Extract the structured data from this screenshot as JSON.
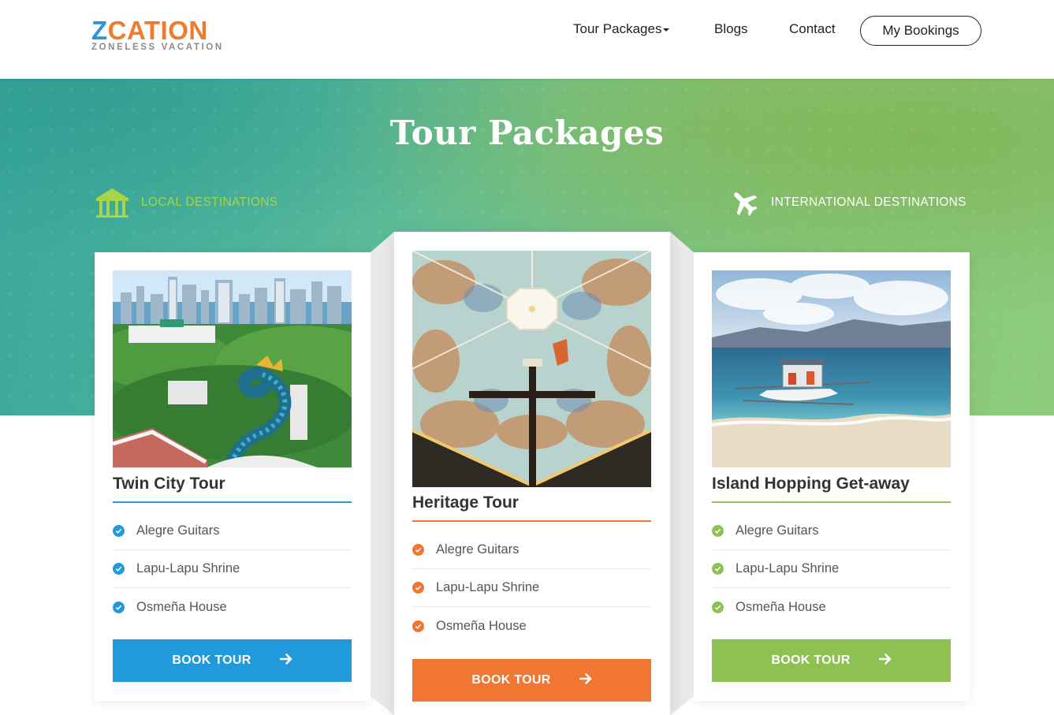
{
  "brand": {
    "logo_first_letter": "Z",
    "logo_rest": "CATION",
    "tagline": "ZONELESS VACATION"
  },
  "nav": {
    "items": [
      "Tour Packages",
      "Blogs",
      "Contact"
    ],
    "bookings_label": "My Bookings"
  },
  "hero": {
    "title": "Tour Packages",
    "local_label": "LOCAL DESTINATIONS",
    "intl_label": "INTERNATIONAL DESTINATIONS"
  },
  "cards": [
    {
      "title": "Twin City Tour",
      "features": [
        "Alegre Guitars",
        "Lapu-Lapu Shrine",
        "Osmeña House"
      ],
      "button": "BOOK TOUR",
      "accent": "#2299da"
    },
    {
      "title": "Heritage Tour",
      "features": [
        "Alegre Guitars",
        "Lapu-Lapu Shrine",
        "Osmeña House"
      ],
      "button": "BOOK TOUR",
      "accent": "#f07631"
    },
    {
      "title": "Island Hopping Get-away",
      "features": [
        "Alegre Guitars",
        "Lapu-Lapu Shrine",
        "Osmeña House"
      ],
      "button": "BOOK TOUR",
      "accent": "#8dc152"
    }
  ],
  "icons": {
    "local": "shrine-icon",
    "international": "airplane-icon",
    "check": "check-circle-icon",
    "arrow": "arrow-right-icon",
    "caret": "caret-down-icon"
  }
}
